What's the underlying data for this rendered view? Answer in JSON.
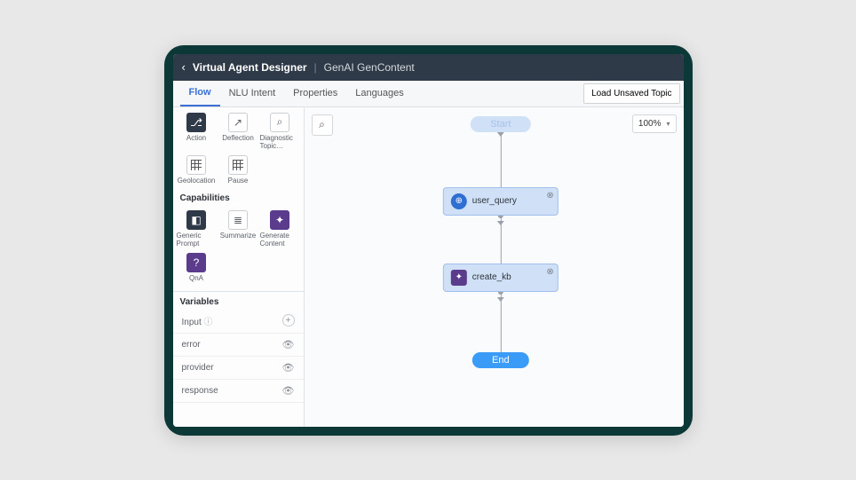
{
  "header": {
    "breadcrumb_root": "Virtual Agent Designer",
    "breadcrumb_current": "GenAI GenContent"
  },
  "tabs": [
    "Flow",
    "NLU Intent",
    "Properties",
    "Languages"
  ],
  "active_tab": "Flow",
  "load_button": "Load Unsaved Topic",
  "palette_row1": [
    {
      "label": "Action"
    },
    {
      "label": "Deflection"
    },
    {
      "label": "Diagnostic Topic…"
    }
  ],
  "palette_row2": [
    {
      "label": "Geolocation"
    },
    {
      "label": "Pause"
    }
  ],
  "capabilities_label": "Capabilities",
  "capabilities": [
    {
      "label": "Generic Prompt"
    },
    {
      "label": "Summarize"
    },
    {
      "label": "Generate Content"
    },
    {
      "label": "QnA"
    }
  ],
  "variables_label": "Variables",
  "variables_input_label": "Input",
  "variables": [
    "error",
    "provider",
    "response"
  ],
  "zoom": "100%",
  "flow": {
    "start": "Start",
    "node1": "user_query",
    "node2": "create_kb",
    "end": "End"
  }
}
